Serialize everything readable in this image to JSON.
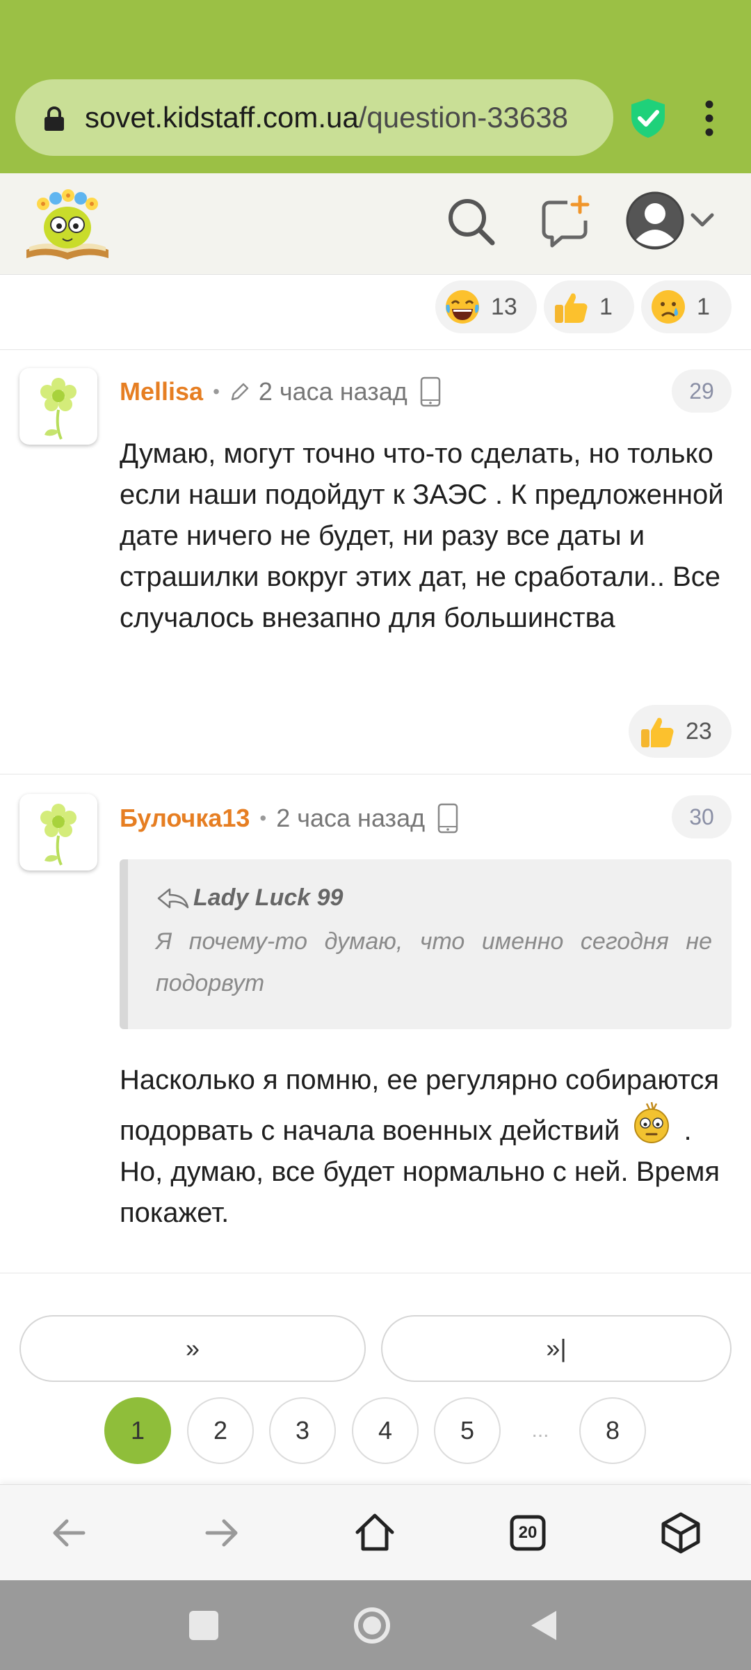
{
  "browser": {
    "url_domain": "sovet.kidstaff.com.ua",
    "url_path": "/question-33638",
    "tab_count": "20"
  },
  "header": {
    "logo_icon": "bookworm-logo",
    "search_icon": "search-icon",
    "new_message_icon": "chat-plus-icon",
    "avatar_icon": "user-avatar-icon"
  },
  "top_reactions": [
    {
      "icon": "laughing-emoji",
      "count": "13"
    },
    {
      "icon": "thumbs-up-emoji",
      "count": "1"
    },
    {
      "icon": "crying-emoji",
      "count": "1"
    }
  ],
  "comments": [
    {
      "author": "Mellisa",
      "time": "2 часа назад",
      "number": "29",
      "edited": true,
      "text": "Думаю, могут точно что-то сделать, но только если наши подойдут к ЗАЭС . К предложенной дате ничего не будет, ни разу все даты и страшилки вокруг этих дат, не сработали.. Все случалось внезапно для большинства",
      "likes": "23"
    },
    {
      "author": "Булочка13",
      "time": "2 часа назад",
      "number": "30",
      "quote_author": "Lady Luck 99",
      "quote_text": "Я почему-то думаю, что именно сегодня не подорвут",
      "text_before_emoji": "Насколько я помню, ее регулярно собираются подорвать с начала военных действий",
      "text_after_emoji": ". Но, думаю, все будет нормально с ней. Время покажет."
    }
  ],
  "pagination": {
    "next_label": "»",
    "last_label": "»|",
    "pages": [
      "1",
      "2",
      "3",
      "4",
      "5",
      "8"
    ],
    "ellipsis": "...",
    "current": "1"
  },
  "colors": {
    "chrome_green": "#9bc045",
    "accent_orange": "#e67e22",
    "active_page": "#8fbe3a"
  }
}
